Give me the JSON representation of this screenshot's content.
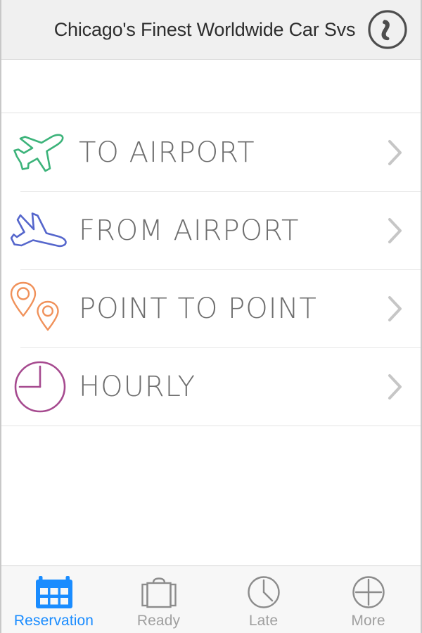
{
  "header": {
    "title": "Chicago's Finest Worldwide Car Svs",
    "call_icon": "phone-icon"
  },
  "colors": {
    "header_bg": "#f0f0f0",
    "accent": "#1a8cff",
    "to_airport": "#3cb37a",
    "from_airport": "#5566cc",
    "point_to_point": "#f0915a",
    "hourly": "#a64a8f",
    "label_text": "#6e6e6e",
    "tab_inactive": "#a0a0a0"
  },
  "services": [
    {
      "label": "TO AIRPORT",
      "icon": "airplane-takeoff-icon",
      "color": "#3cb37a",
      "chevron": "chevron-right-icon"
    },
    {
      "label": "FROM AIRPORT",
      "icon": "airplane-landing-icon",
      "color": "#5566cc",
      "chevron": "chevron-right-icon"
    },
    {
      "label": "POINT TO POINT",
      "icon": "map-pins-icon",
      "color": "#f0915a",
      "chevron": "chevron-right-icon"
    },
    {
      "label": "HOURLY",
      "icon": "clock-icon",
      "color": "#a64a8f",
      "chevron": "chevron-right-icon"
    }
  ],
  "tabs": [
    {
      "label": "Reservation",
      "icon": "calendar-icon",
      "active": true
    },
    {
      "label": "Ready",
      "icon": "briefcase-icon",
      "active": false
    },
    {
      "label": "Late",
      "icon": "clock-icon",
      "active": false
    },
    {
      "label": "More",
      "icon": "plus-circle-icon",
      "active": false
    }
  ]
}
